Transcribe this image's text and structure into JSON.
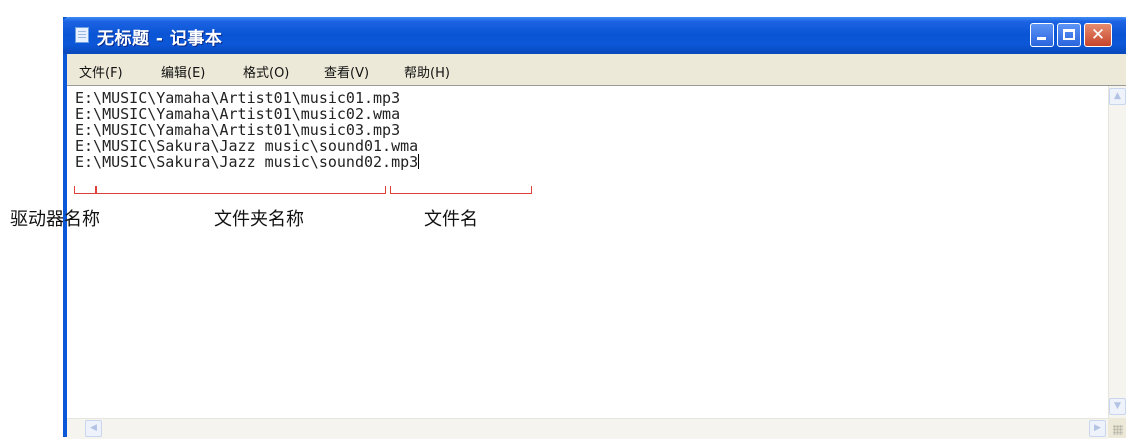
{
  "window": {
    "title": "无标题 - 记事本",
    "controls": {
      "close_glyph": "✕"
    }
  },
  "menubar": {
    "items": [
      {
        "label": "文件(F)"
      },
      {
        "label": "编辑(E)"
      },
      {
        "label": "格式(O)"
      },
      {
        "label": "查看(V)"
      },
      {
        "label": "帮助(H)"
      }
    ]
  },
  "editor": {
    "lines": [
      "E:\\MUSIC\\Yamaha\\Artist01\\music01.mp3",
      "E:\\MUSIC\\Yamaha\\Artist01\\music02.wma",
      "E:\\MUSIC\\Yamaha\\Artist01\\music03.mp3",
      "E:\\MUSIC\\Sakura\\Jazz music\\sound01.wma",
      "E:\\MUSIC\\Sakura\\Jazz music\\sound02.mp3"
    ]
  },
  "annotations": {
    "drive": "驱动器名称",
    "folder": "文件夹名称",
    "file": "文件名"
  },
  "colors": {
    "titlebar": "#0a55d6",
    "bracket": "#e0403a",
    "close_button": "#c7442a"
  },
  "icons": [
    "notepad-icon",
    "minimize-icon",
    "maximize-icon",
    "close-icon",
    "scroll-up-icon",
    "scroll-down-icon",
    "scroll-left-icon",
    "scroll-right-icon",
    "resize-grip-icon"
  ]
}
